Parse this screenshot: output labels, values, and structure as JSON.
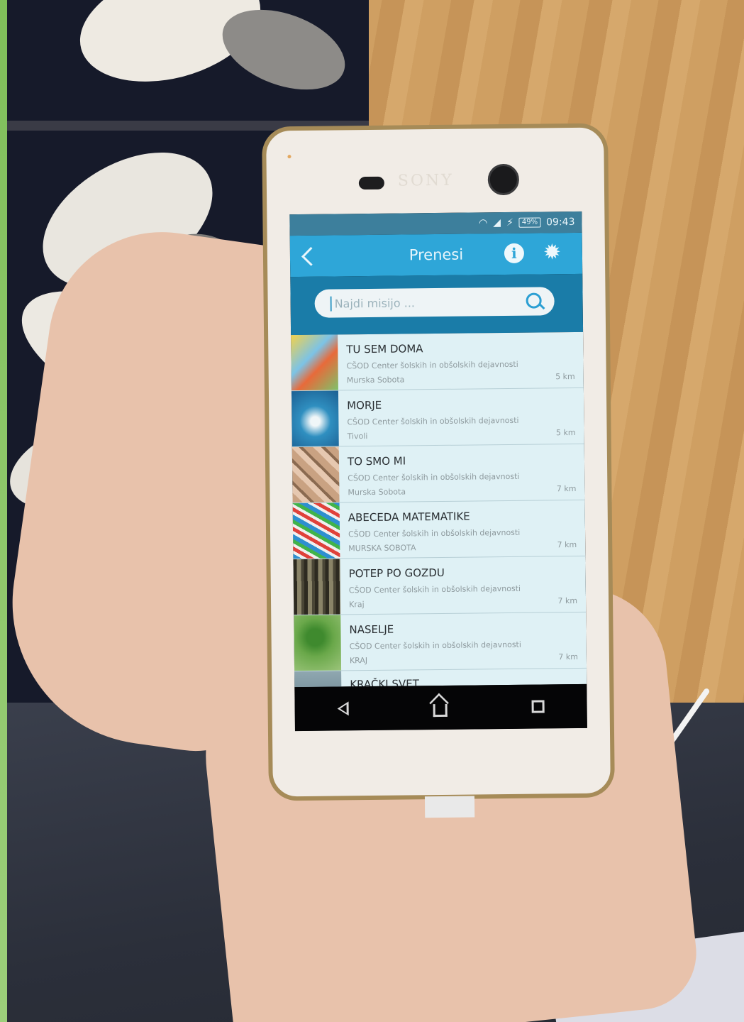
{
  "phone": {
    "brand": "SONY"
  },
  "status_bar": {
    "battery": "49%",
    "time": "09:43"
  },
  "app_bar": {
    "title": "Prenesi"
  },
  "search": {
    "placeholder": "Najdi misijo ..."
  },
  "missions": [
    {
      "title": "TU SEM DOMA",
      "organization": "CŠOD Center šolskih in obšolskih dejavnosti",
      "location": "Murska Sobota",
      "distance": "5 km"
    },
    {
      "title": "MORJE",
      "organization": "CŠOD Center šolskih in obšolskih dejavnosti",
      "location": "Tivoli",
      "distance": "5 km"
    },
    {
      "title": "TO SMO MI",
      "organization": "CŠOD Center šolskih in obšolskih dejavnosti",
      "location": "Murska Sobota",
      "distance": "7 km"
    },
    {
      "title": "ABECEDA MATEMATIKE",
      "organization": "CŠOD Center šolskih in obšolskih dejavnosti",
      "location": "MURSKA SOBOTA",
      "distance": "7 km"
    },
    {
      "title": "POTEP PO GOZDU",
      "organization": "CŠOD Center šolskih in obšolskih dejavnosti",
      "location": "Kraj",
      "distance": "7 km"
    },
    {
      "title": "NASELJE",
      "organization": "CŠOD Center šolskih in obšolskih dejavnosti",
      "location": "KRAJ",
      "distance": "7 km"
    },
    {
      "title": "KRAČKI SVET"
    }
  ],
  "colors": {
    "app_bar": "#2ea6d8",
    "search_band": "#1a7ca8",
    "list_background": "#dff1f5"
  },
  "icons": [
    "back-icon",
    "info-icon",
    "gear-icon",
    "search-icon",
    "wifi-icon",
    "signal-icon",
    "charging-icon",
    "nav-back-icon",
    "nav-home-icon",
    "nav-recent-icon"
  ]
}
